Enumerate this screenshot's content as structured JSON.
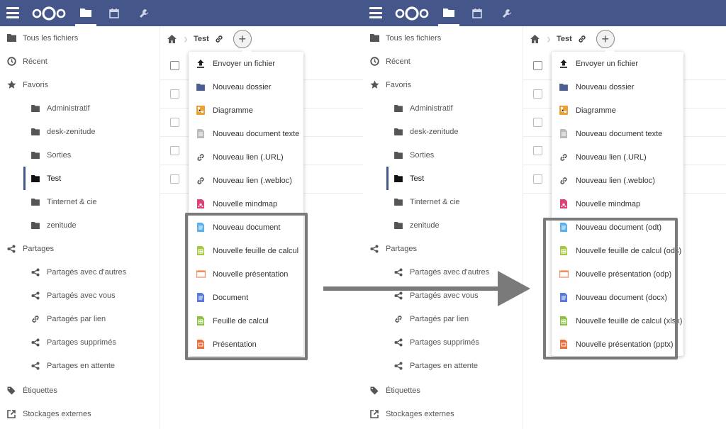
{
  "sidebar": {
    "items": [
      {
        "label": "Tous les fichiers",
        "icon": "folder-icon",
        "level": 0
      },
      {
        "label": "Récent",
        "icon": "clock-icon",
        "level": 0
      },
      {
        "label": "Favoris",
        "icon": "star-icon",
        "level": 0
      },
      {
        "label": "Administratif",
        "icon": "folder-icon",
        "level": 1
      },
      {
        "label": "desk-zenitude",
        "icon": "folder-icon",
        "level": 1
      },
      {
        "label": "Sorties",
        "icon": "folder-icon",
        "level": 1
      },
      {
        "label": "Test",
        "icon": "folder-icon",
        "level": 1,
        "selected": true
      },
      {
        "label": "Tinternet & cie",
        "icon": "folder-icon",
        "level": 1
      },
      {
        "label": "zenitude",
        "icon": "folder-icon",
        "level": 1
      },
      {
        "label": "Partages",
        "icon": "share-icon",
        "level": 0
      },
      {
        "label": "Partagés avec d'autres",
        "icon": "share-icon",
        "level": 1
      },
      {
        "label": "Partagés avec vous",
        "icon": "share-icon",
        "level": 1
      },
      {
        "label": "Partagés par lien",
        "icon": "link-icon",
        "level": 1
      },
      {
        "label": "Partages supprimés",
        "icon": "share-deleted-icon",
        "level": 1
      },
      {
        "label": "Partages en attente",
        "icon": "share-icon",
        "level": 1
      },
      {
        "label": "Étiquettes",
        "icon": "tag-icon",
        "level": 0
      },
      {
        "label": "Stockages externes",
        "icon": "external-icon",
        "level": 0
      }
    ]
  },
  "breadcrumb": {
    "current": "Test"
  },
  "menu_left": {
    "items": [
      {
        "label": "Envoyer un fichier",
        "icon": "upload-icon"
      },
      {
        "label": "Nouveau dossier",
        "icon": "folder-icon"
      },
      {
        "label": "Diagramme",
        "icon": "diagram-icon"
      },
      {
        "label": "Nouveau document texte",
        "icon": "text-file-icon"
      },
      {
        "label": "Nouveau lien (.URL)",
        "icon": "link-icon"
      },
      {
        "label": "Nouveau lien (.webloc)",
        "icon": "link-icon"
      },
      {
        "label": "Nouvelle mindmap",
        "icon": "mindmap-icon"
      },
      {
        "label": "Nouveau document",
        "icon": "document-icon"
      },
      {
        "label": "Nouvelle feuille de calcul",
        "icon": "spreadsheet-icon"
      },
      {
        "label": "Nouvelle présentation",
        "icon": "presentation-icon"
      },
      {
        "label": "Document",
        "icon": "document-blue-icon"
      },
      {
        "label": "Feuille de calcul",
        "icon": "spreadsheet-icon"
      },
      {
        "label": "Présentation",
        "icon": "presentation-orange-icon"
      }
    ]
  },
  "menu_right": {
    "items": [
      {
        "label": "Envoyer un fichier",
        "icon": "upload-icon"
      },
      {
        "label": "Nouveau dossier",
        "icon": "folder-icon"
      },
      {
        "label": "Diagramme",
        "icon": "diagram-icon"
      },
      {
        "label": "Nouveau document texte",
        "icon": "text-file-icon"
      },
      {
        "label": "Nouveau lien (.URL)",
        "icon": "link-icon"
      },
      {
        "label": "Nouveau lien (.webloc)",
        "icon": "link-icon"
      },
      {
        "label": "Nouvelle mindmap",
        "icon": "mindmap-icon"
      },
      {
        "label": "Nouveau document (odt)",
        "icon": "document-icon"
      },
      {
        "label": "Nouvelle feuille de calcul (ods)",
        "icon": "spreadsheet-icon"
      },
      {
        "label": "Nouvelle présentation (odp)",
        "icon": "presentation-icon"
      },
      {
        "label": "Nouveau document (docx)",
        "icon": "document-blue-icon"
      },
      {
        "label": "Nouvelle feuille de calcul (xlsx)",
        "icon": "spreadsheet-icon"
      },
      {
        "label": "Nouvelle présentation (pptx)",
        "icon": "presentation-orange-icon"
      }
    ]
  },
  "colors": {
    "header": "#45578a",
    "accent": "#45578a",
    "highlight_frame": "#7a7a7a",
    "arrow": "#7a7a7a"
  }
}
